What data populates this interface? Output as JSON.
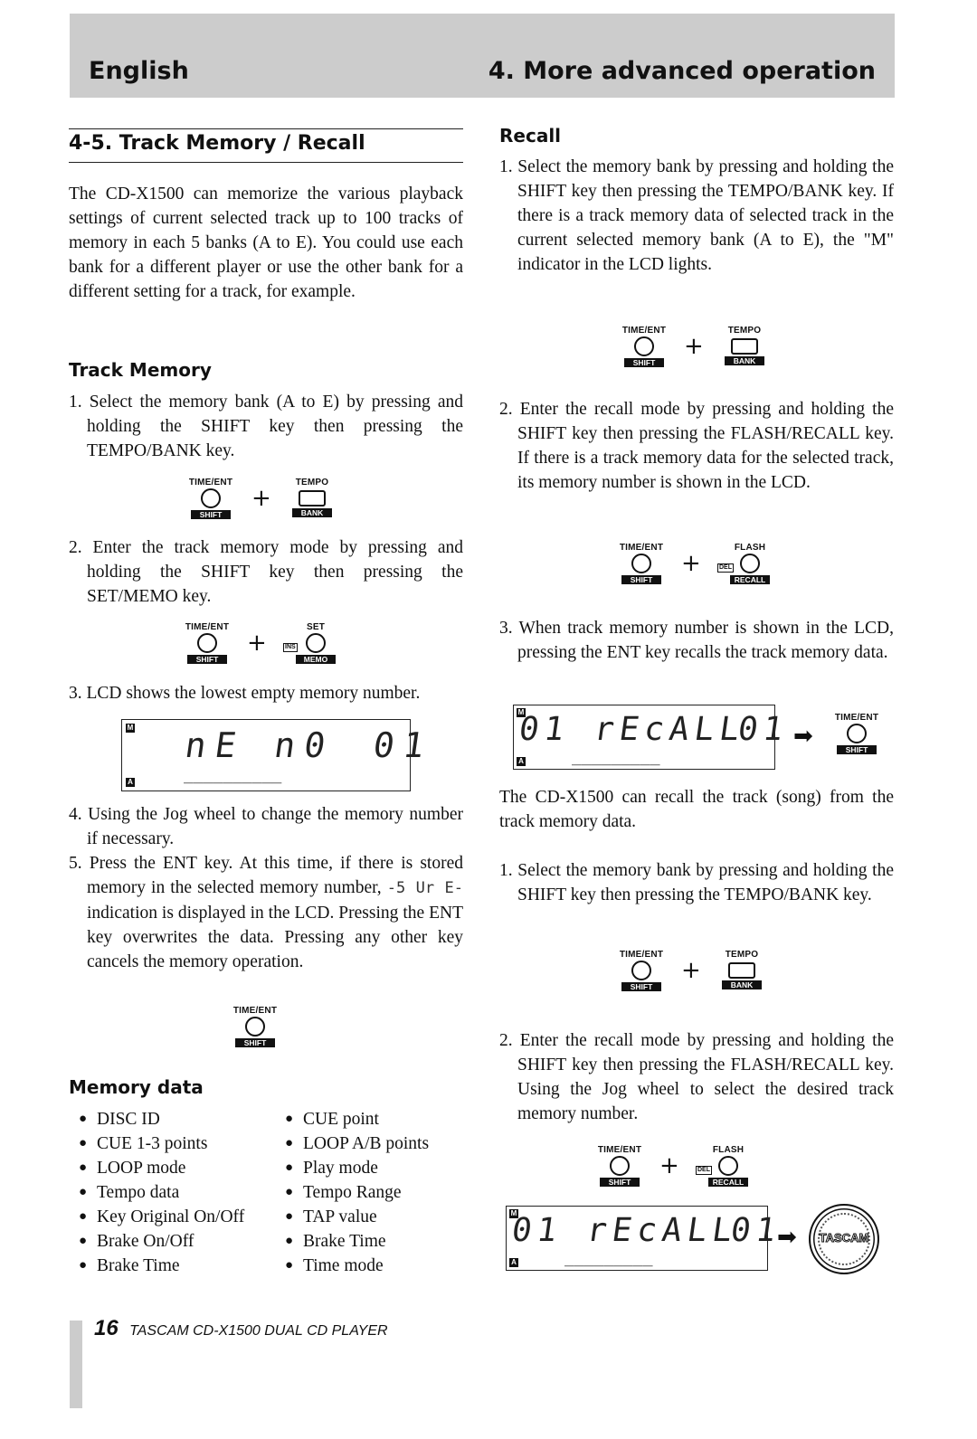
{
  "header": {
    "language": "English",
    "chapter": "4. More advanced operation"
  },
  "section": {
    "title": "4-5. Track Memory / Recall"
  },
  "intro": "The CD-X1500 can memorize the various playback settings of current selected track up to 100 tracks of memory in each 5 banks (A to E). You could use each bank for a different player or use the other bank for a different setting for a track, for example.",
  "track_memory": {
    "heading": "Track Memory",
    "steps": [
      "1. Select the memory bank (A to E) by pressing and holding the SHIFT key then pressing the TEMPO/BANK key.",
      "2. Enter the track memory mode by pressing and holding the SHIFT key then pressing the SET/MEMO key.",
      "3. LCD shows the lowest empty memory number.",
      "4. Using the Jog wheel to change the memory number if necessary.",
      "5. Press the ENT key. At this time, if there is stored memory in the selected memory number, -SUrE- indication is displayed in the LCD. Pressing the ENT key overwrites the data. Pressing any other key cancels the memory operation."
    ],
    "step5_parts": {
      "before": "5. Press the ENT key. At this time, if there is stored memory in the selected memory number,",
      "lcd_glyph": "-5 Ur E-",
      "after": " indication is displayed in the LCD. Pressing the ENT key overwrites the data. Pressing any other key cancels the memory operation."
    },
    "lcd": {
      "indicator_top": "M",
      "indicator_bottom": "A",
      "text": "nE n0",
      "number": "01",
      "underline": "__________"
    }
  },
  "keys": {
    "time_ent": "TIME/ENT",
    "shift": "SHIFT",
    "tempo": "TEMPO",
    "bank": "BANK",
    "set": "SET",
    "memo": "MEMO",
    "ins": "INS",
    "flash": "FLASH",
    "recall": "RECALL",
    "del": "DEL",
    "plus": "+",
    "arrow": "➡"
  },
  "memory_data": {
    "heading": "Memory data",
    "left": [
      "DISC ID",
      "CUE 1-3 points",
      "LOOP mode",
      "Tempo data",
      "Key Original On/Off",
      "Brake On/Off",
      "Brake Time"
    ],
    "right": [
      "CUE point",
      "LOOP A/B points",
      "Play mode",
      "Tempo Range",
      "TAP value",
      "Brake Time",
      "Time mode"
    ]
  },
  "recall": {
    "heading": "Recall",
    "steps_a": [
      "1. Select the memory bank by pressing and holding the SHIFT key then pressing the TEMPO/BANK key. If there is a track memory data of selected track in the current selected memory bank (A to E), the \"M\" indicator in the LCD lights.",
      "2. Enter the recall mode by pressing and holding the SHIFT key then pressing the FLASH/RECALL key. If there is a track memory data for the selected track, its memory number is shown in the LCD.",
      "3. When track memory number is shown in the LCD, pressing the ENT key recalls the track memory data."
    ],
    "lcd": {
      "indicator_top": "M",
      "indicator_bottom": "A",
      "text": "01 rEcALL",
      "number": "01",
      "underline": "_________"
    },
    "note": "The CD-X1500 can recall the track (song) from the track memory data.",
    "steps_b": [
      "1. Select the memory bank by pressing and holding the SHIFT key then pressing the TEMPO/BANK key.",
      "2. Enter the recall mode by pressing and holding the SHIFT key then pressing the FLASH/RECALL key. Using the Jog wheel to select the desired track memory number."
    ],
    "jog_label": "TASCAM"
  },
  "footer": {
    "page": "16",
    "product": "TASCAM  CD-X1500  DUAL CD PLAYER"
  }
}
